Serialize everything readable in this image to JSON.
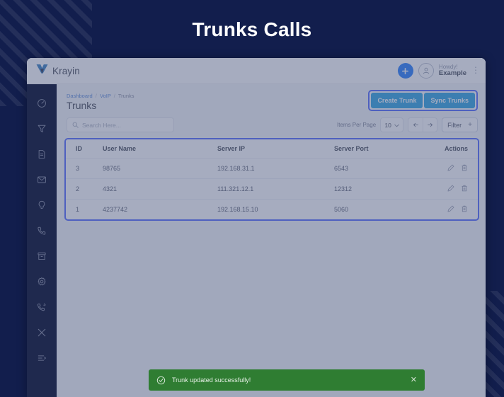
{
  "banner": {
    "title": "Trunks Calls"
  },
  "brand": {
    "name": "Krayin",
    "logo_icon": "krayin-logo-icon"
  },
  "topbar": {
    "add_icon": "plus-icon",
    "avatar_icon": "user-avatar-icon",
    "greeting": "Howdy!",
    "user_name": "Example",
    "menu_icon": "kebab-menu-icon"
  },
  "sidebar": {
    "items": [
      {
        "icon": "dashboard-gauge-icon",
        "label": "Dashboard"
      },
      {
        "icon": "funnel-filter-icon",
        "label": "Leads"
      },
      {
        "icon": "document-icon",
        "label": "Quotes"
      },
      {
        "icon": "mail-envelope-icon",
        "label": "Mail"
      },
      {
        "icon": "lightbulb-icon",
        "label": "Activities"
      },
      {
        "icon": "phone-handset-icon",
        "label": "Contacts"
      },
      {
        "icon": "archive-box-icon",
        "label": "Products"
      },
      {
        "icon": "gear-settings-icon",
        "label": "Settings"
      },
      {
        "icon": "phone-ring-icon",
        "label": "VoIP"
      },
      {
        "icon": "tools-wrench-icon",
        "label": "Configuration"
      },
      {
        "icon": "list-arrow-icon",
        "label": "Collapse"
      }
    ]
  },
  "breadcrumb": {
    "items": [
      "Dashboard",
      "VoIP",
      "Trunks"
    ],
    "separator": "/"
  },
  "page": {
    "title": "Trunks"
  },
  "search": {
    "placeholder": "Search Here...",
    "value": "",
    "icon": "search-icon"
  },
  "toolbar": {
    "items_per_page_label": "Items Per Page",
    "items_per_page_value": "10",
    "caret_icon": "chevron-down-icon",
    "prev_icon": "arrow-left-icon",
    "next_icon": "arrow-right-icon",
    "filter_label": "Filter",
    "filter_plus": "+"
  },
  "actions": {
    "create_label": "Create Trunk",
    "sync_label": "Sync Trunks"
  },
  "table": {
    "columns": [
      "ID",
      "User Name",
      "Server IP",
      "Server Port",
      "Actions"
    ],
    "rows": [
      {
        "id": "3",
        "user_name": "98765",
        "server_ip": "192.168.31.1",
        "server_port": "6543"
      },
      {
        "id": "2",
        "user_name": "4321",
        "server_ip": "111.321.12.1",
        "server_port": "12312"
      },
      {
        "id": "1",
        "user_name": "4237742",
        "server_ip": "192.168.15.10",
        "server_port": "5060"
      }
    ],
    "edit_icon": "pencil-edit-icon",
    "delete_icon": "trash-delete-icon"
  },
  "toast": {
    "message": "Trunk updated successfully!",
    "check_icon": "check-circle-icon",
    "close_icon": "close-x-icon",
    "color": "#2f7d32"
  },
  "colors": {
    "page_bg": "#121e4d",
    "sidebar": "#1b2447",
    "primary_button": "#169ae0",
    "highlight_border": "#3d57ff",
    "accent_blue": "#0d6efd"
  }
}
